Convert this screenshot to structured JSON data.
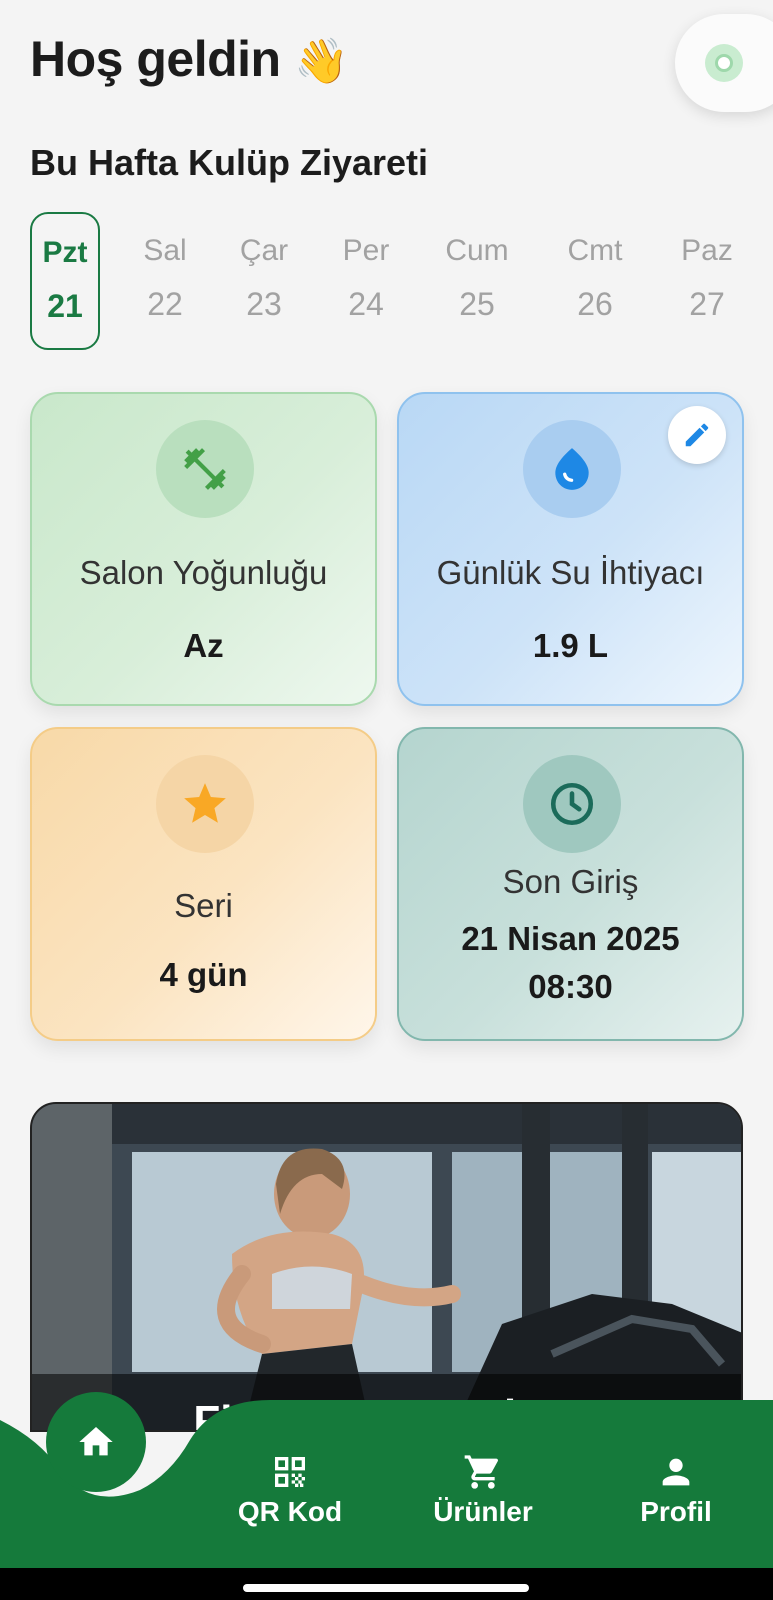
{
  "header": {
    "greeting": "Hoş geldin",
    "wave_emoji": "👋"
  },
  "status_indicator": {
    "color": "#9ed8ab"
  },
  "visits": {
    "title": "Bu Hafta Kulüp Ziyareti",
    "days": [
      {
        "name": "Pzt",
        "num": "21",
        "active": true
      },
      {
        "name": "Sal",
        "num": "22",
        "active": false
      },
      {
        "name": "Çar",
        "num": "23",
        "active": false
      },
      {
        "name": "Per",
        "num": "24",
        "active": false
      },
      {
        "name": "Cum",
        "num": "25",
        "active": false
      },
      {
        "name": "Cmt",
        "num": "26",
        "active": false
      },
      {
        "name": "Paz",
        "num": "27",
        "active": false
      }
    ]
  },
  "cards": {
    "density": {
      "label": "Salon Yoğunluğu",
      "value": "Az",
      "icon": "dumbbell-icon",
      "color": "#43a047"
    },
    "water": {
      "label": "Günlük Su İhtiyacı",
      "value": "1.9 L",
      "icon": "water-drop-icon",
      "color": "#1e88e5"
    },
    "streak": {
      "label": "Seri",
      "value": "4 gün",
      "icon": "star-icon",
      "color": "#f9a825"
    },
    "last_entry": {
      "label": "Son Giriş",
      "value_date": "21 Nisan 2025",
      "value_time": "08:30",
      "icon": "clock-icon",
      "color": "#1b6b5a"
    }
  },
  "banner": {
    "caption": "Fitness Hayatı İçin"
  },
  "nav": {
    "home_icon": "home-icon",
    "items": [
      {
        "label": "QR Kod",
        "icon": "qr-code-icon"
      },
      {
        "label": "Ürünler",
        "icon": "cart-icon"
      },
      {
        "label": "Profil",
        "icon": "person-icon"
      }
    ],
    "color": "#157a3b"
  }
}
